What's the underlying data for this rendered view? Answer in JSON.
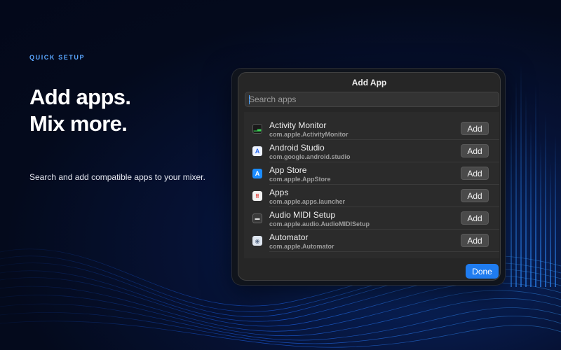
{
  "hero": {
    "eyebrow": "QUICK SETUP",
    "headline_line1": "Add apps.",
    "headline_line2": "Mix more.",
    "subtitle": "Search and add compatible apps to your mixer."
  },
  "dialog": {
    "title": "Add App",
    "search_placeholder": "Search apps",
    "done_label": "Done",
    "add_label": "Add",
    "apps": [
      {
        "name": "Activity Monitor",
        "bundle_id": "com.apple.ActivityMonitor",
        "icon": "activity-monitor-icon"
      },
      {
        "name": "Android Studio",
        "bundle_id": "com.google.android.studio",
        "icon": "android-studio-icon"
      },
      {
        "name": "App Store",
        "bundle_id": "com.apple.AppStore",
        "icon": "app-store-icon"
      },
      {
        "name": "Apps",
        "bundle_id": "com.apple.apps.launcher",
        "icon": "apps-launcher-icon"
      },
      {
        "name": "Audio MIDI Setup",
        "bundle_id": "com.apple.audio.AudioMIDISetup",
        "icon": "audio-midi-icon"
      },
      {
        "name": "Automator",
        "bundle_id": "com.apple.Automator",
        "icon": "automator-icon"
      }
    ]
  },
  "colors": {
    "accent": "#5aa6ff",
    "button_primary": "#1f7cf0",
    "background": "#040a1c"
  }
}
